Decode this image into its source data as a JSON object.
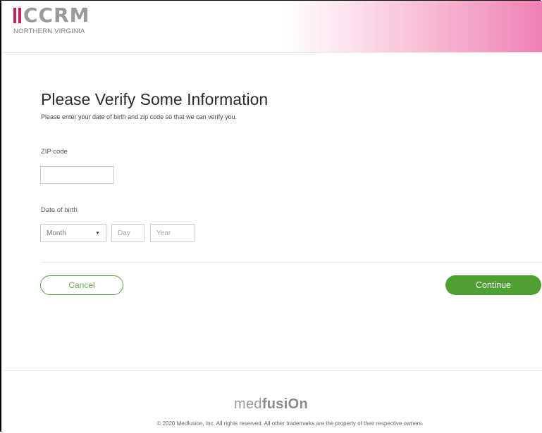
{
  "header": {
    "logo_text": "CCRM",
    "logo_subtitle": "NORTHERN VIRGINIA",
    "accent_color": "#c8235f"
  },
  "main": {
    "title": "Please Verify Some Information",
    "subtitle": "Please enter your date of birth and zip code so that we can verify you.",
    "zip": {
      "label": "ZIP code",
      "value": "",
      "placeholder": ""
    },
    "dob": {
      "label": "Date of birth",
      "month": {
        "selected": "Month"
      },
      "day_placeholder": "Day",
      "year_placeholder": "Year"
    }
  },
  "actions": {
    "cancel_label": "Cancel",
    "continue_label": "Continue",
    "primary_color": "#4fa033"
  },
  "footer": {
    "brand_light": "med",
    "brand_bold": "fusiOn",
    "copyright": "© 2020 Medfusion, Inc. All rights reserved. All other trademarks are the property of their respective owners."
  }
}
